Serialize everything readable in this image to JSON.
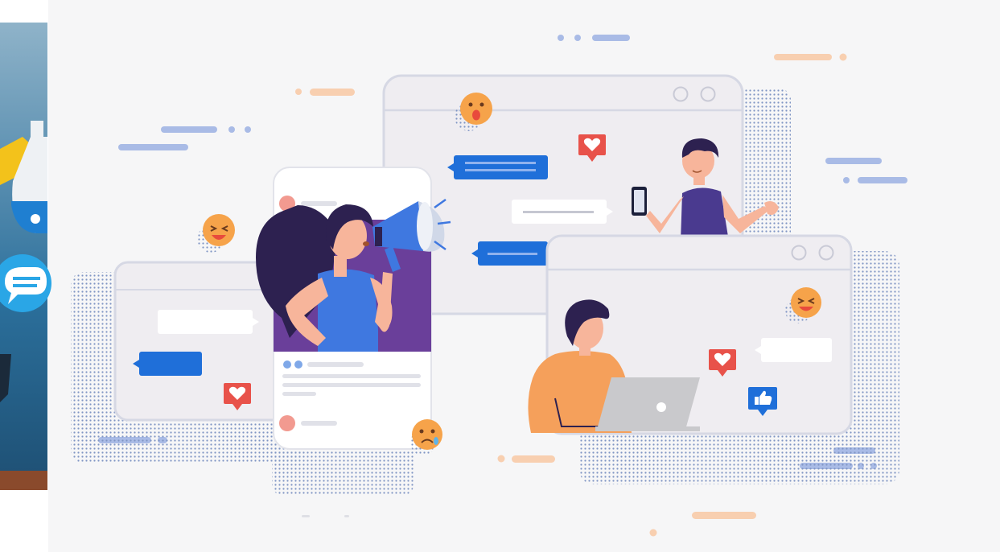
{
  "palette": {
    "background": "#f6f6f7",
    "window_fill": "#efedf1",
    "window_border": "#d6d8e4",
    "dot_pattern": "#7f95c4",
    "accent_blue": "#1f6fd9",
    "soft_blue": "#a9bbe6",
    "peach": "#f8cfb0",
    "heart_red": "#e8524a",
    "emoji_orange": "#f6a34a",
    "purple": "#4a3a8f",
    "dark_purple": "#2d2150",
    "person_blue": "#3f78e0",
    "orange_shirt": "#f5a05b",
    "skin": "#f7b59b",
    "laptop_gray": "#c9c9cc"
  },
  "elements": {
    "left_photo": [
      "flask-icon",
      "chat-bubble-icon"
    ],
    "reactions": [
      "heart-icon",
      "thumbs-up-icon",
      "shocked-emoji",
      "laughing-emoji",
      "sad-emoji"
    ],
    "people": [
      "woman-with-megaphone",
      "man-with-phone",
      "woman-with-laptop"
    ]
  }
}
